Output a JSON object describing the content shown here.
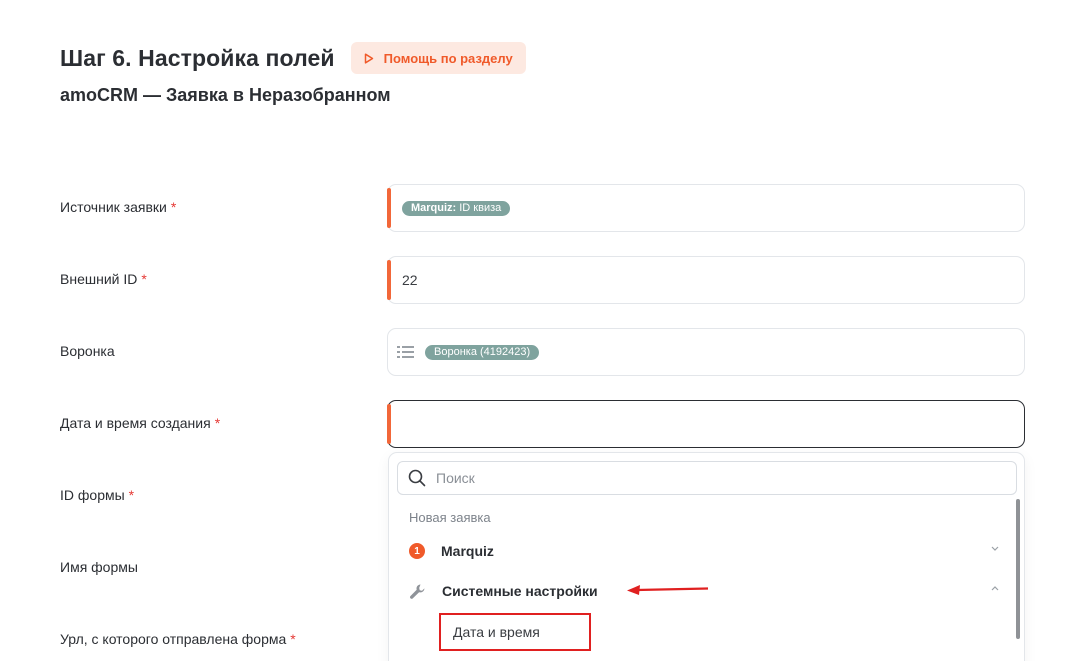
{
  "header": {
    "title": "Шаг 6. Настройка полей",
    "help_label": "Помощь по разделу",
    "subtitle": "amoCRM — Заявка в Неразобранном"
  },
  "fields": [
    {
      "label": "Источник заявки",
      "required": "*",
      "chip_prefix": "Marquiz:",
      "chip_text": "ID квиза"
    },
    {
      "label": "Внешний ID",
      "required": "*",
      "value": "22"
    },
    {
      "label": "Воронка",
      "chip_text": "Воронка (4192423)"
    },
    {
      "label": "Дата и время создания",
      "required": "*"
    },
    {
      "label": "ID формы",
      "required": "*"
    },
    {
      "label": "Имя формы"
    },
    {
      "label": "Урл, с которого отправлена форма",
      "required": "*"
    }
  ],
  "dropdown": {
    "search_placeholder": "Поиск",
    "group_title": "Новая заявка",
    "options": [
      {
        "badge": "1",
        "label": "Marquiz",
        "icon": "number-badge",
        "chevron": "chevron-down-icon"
      },
      {
        "label": "Системные настройки",
        "icon": "wrench-icon",
        "chevron": "chevron-up-icon"
      }
    ],
    "sub_item": "Дата и время"
  },
  "colors": {
    "accent": "#f05a2a",
    "required_bar": "#f26739",
    "chip": "#7fa39e",
    "highlight": "#e02020"
  }
}
